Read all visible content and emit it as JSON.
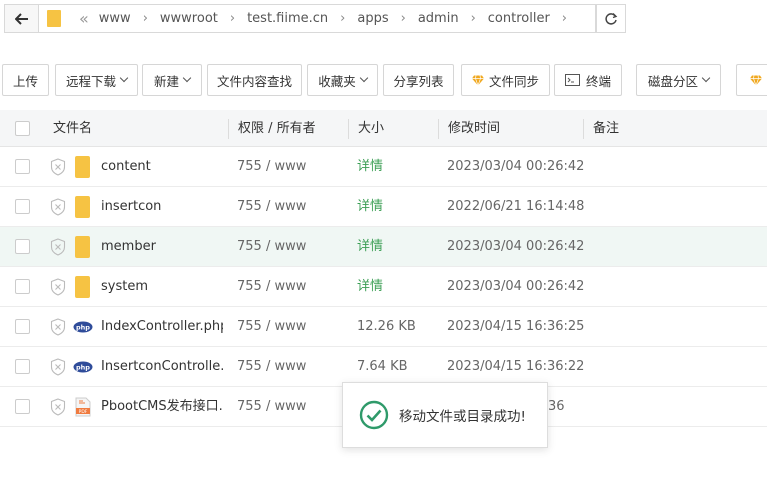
{
  "address_bar": {
    "crumbs": [
      "www",
      "wwwroot",
      "test.fiime.cn",
      "apps",
      "admin",
      "controller"
    ]
  },
  "toolbar": {
    "upload": "上传",
    "remote_download": "远程下载",
    "new": "新建",
    "content_search": "文件内容查找",
    "favorites": "收藏夹",
    "share_list": "分享列表",
    "file_sync": "文件同步",
    "terminal": "终端",
    "disk_partition": "磁盘分区"
  },
  "table": {
    "headers": {
      "name": "文件名",
      "permission": "权限 / 所有者",
      "size": "大小",
      "modified": "修改时间",
      "note": "备注"
    },
    "rows": [
      {
        "type": "folder",
        "name": "content",
        "perm": "755 / www",
        "size": "详情",
        "time": "2023/03/04 00:26:42"
      },
      {
        "type": "folder",
        "name": "insertcon",
        "perm": "755 / www",
        "size": "详情",
        "time": "2022/06/21 16:14:48"
      },
      {
        "type": "folder",
        "name": "member",
        "perm": "755 / www",
        "size": "详情",
        "time": "2023/03/04 00:26:42"
      },
      {
        "type": "folder",
        "name": "system",
        "perm": "755 / www",
        "size": "详情",
        "time": "2023/03/04 00:26:42"
      },
      {
        "type": "php",
        "name": "IndexController.php",
        "perm": "755 / www",
        "size": "12.26 KB",
        "time": "2023/04/15 16:36:25"
      },
      {
        "type": "php",
        "name": "InsertconControlle...",
        "perm": "755 / www",
        "size": "7.64 KB",
        "time": "2023/04/15 16:36:22"
      },
      {
        "type": "pdf",
        "name": "PbootCMS发布接口...",
        "perm": "755 / www",
        "size": "",
        "time": "36"
      }
    ]
  },
  "toast": {
    "message": "移动文件或目录成功!"
  },
  "colors": {
    "accent_green": "#3d9f56",
    "folder_yellow": "#f6c343",
    "php_blue": "#2f4c9a"
  }
}
